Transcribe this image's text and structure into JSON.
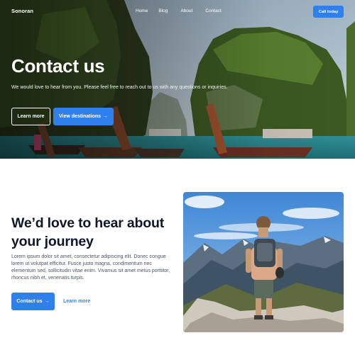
{
  "nav": {
    "brand": "Sonoran",
    "links": [
      "Home",
      "Blog",
      "About",
      "Contact"
    ],
    "cta_label": "Call today"
  },
  "hero": {
    "title": "Contact us",
    "subtitle": "We would love to hear from you. Please feel free to reach out to us with any questions or inquiries.",
    "primary_button": "Learn more",
    "secondary_button": "View destinations",
    "secondary_arrow": "→"
  },
  "section": {
    "title": "We’d love to hear about your journey",
    "body": "Lorem ipsum dolor sit amet, consectetur adipiscing elit. Donec congue lorem ut volutpat efficitur. Fusce justo magna, condimentum nec elementum sed, sollicitudin vitae enim. Vivamus sit amet metus porttitor, rhoncus nibh et, venenatis turpis.",
    "contact_button": "Contact us",
    "contact_arrow": "→",
    "learn_more_link": "Learn more"
  },
  "colors": {
    "accent": "#2f80ed",
    "heading": "#0f172a",
    "body_text": "#4b5563"
  }
}
